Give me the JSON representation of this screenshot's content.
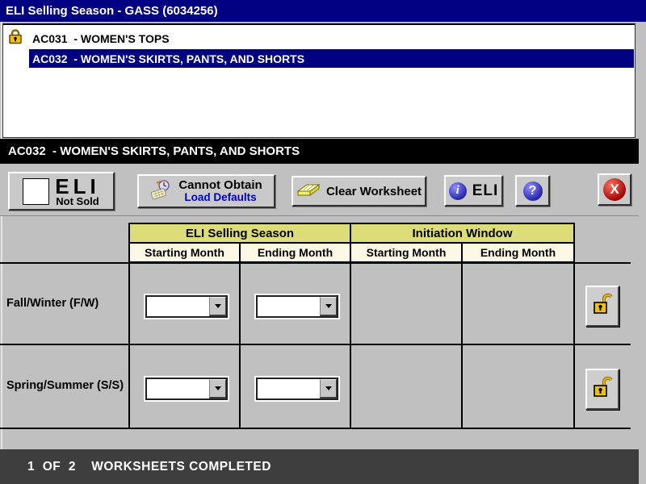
{
  "window": {
    "title": "ELI Selling Season - GASS (6034256)"
  },
  "category_list": {
    "items": [
      {
        "text": "AC031  - WOMEN'S TOPS",
        "selected": false,
        "locked": true
      },
      {
        "text": "AC032  - WOMEN'S SKIRTS, PANTS, AND SHORTS",
        "selected": true,
        "locked": false
      }
    ]
  },
  "selected_banner": "AC032  - WOMEN'S SKIRTS, PANTS, AND SHORTS",
  "toolbar": {
    "eli_not_sold_button": {
      "line1": "ELI",
      "line2": "Not Sold"
    },
    "cannot_obtain_button": {
      "line1": "Cannot Obtain",
      "line2": "Load Defaults"
    },
    "clear_worksheet_button": {
      "label": "Clear Worksheet"
    },
    "eli_info_button": {
      "info_glyph": "i",
      "label": "ELI"
    },
    "help_button": {
      "label": "?"
    },
    "close_button": {
      "label": "X"
    }
  },
  "worksheet": {
    "group_headers": [
      "ELI Selling Season",
      "Initiation Window"
    ],
    "column_headers": [
      "Starting Month",
      "Ending Month",
      "Starting Month",
      "Ending Month"
    ],
    "rows": [
      {
        "label": "Fall/Winter (F/W)",
        "eli_starting_month": "",
        "eli_ending_month": "",
        "init_starting_month": "",
        "init_ending_month": ""
      },
      {
        "label": "Spring/Summer (S/S)",
        "eli_starting_month": "",
        "eli_ending_month": "",
        "init_starting_month": "",
        "init_ending_month": ""
      }
    ]
  },
  "status_bar": {
    "text": "1  OF  2    WORKSHEETS COMPLETED"
  },
  "colors": {
    "titlebar": "#000080",
    "selection": "#000080",
    "group_header_bg": "#dcdc78",
    "column_header_bg": "#fcf8e6",
    "status_bar_bg": "#3e3e3e",
    "load_defaults_text": "#0000cc",
    "close_button_red": "#cc0000",
    "lock_gold": "#f2c200"
  }
}
